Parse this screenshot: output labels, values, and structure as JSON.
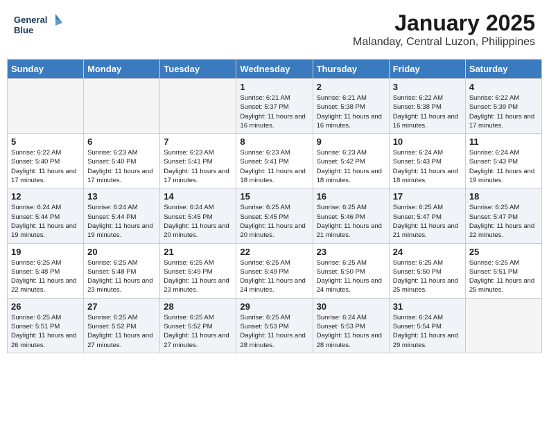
{
  "logo": {
    "line1": "General",
    "line2": "Blue"
  },
  "title": "January 2025",
  "subtitle": "Malanday, Central Luzon, Philippines",
  "days_of_week": [
    "Sunday",
    "Monday",
    "Tuesday",
    "Wednesday",
    "Thursday",
    "Friday",
    "Saturday"
  ],
  "weeks": [
    [
      {
        "day": "",
        "info": ""
      },
      {
        "day": "",
        "info": ""
      },
      {
        "day": "",
        "info": ""
      },
      {
        "day": "1",
        "info": "Sunrise: 6:21 AM\nSunset: 5:37 PM\nDaylight: 11 hours and 16 minutes."
      },
      {
        "day": "2",
        "info": "Sunrise: 6:21 AM\nSunset: 5:38 PM\nDaylight: 11 hours and 16 minutes."
      },
      {
        "day": "3",
        "info": "Sunrise: 6:22 AM\nSunset: 5:38 PM\nDaylight: 11 hours and 16 minutes."
      },
      {
        "day": "4",
        "info": "Sunrise: 6:22 AM\nSunset: 5:39 PM\nDaylight: 11 hours and 17 minutes."
      }
    ],
    [
      {
        "day": "5",
        "info": "Sunrise: 6:22 AM\nSunset: 5:40 PM\nDaylight: 11 hours and 17 minutes."
      },
      {
        "day": "6",
        "info": "Sunrise: 6:23 AM\nSunset: 5:40 PM\nDaylight: 11 hours and 17 minutes."
      },
      {
        "day": "7",
        "info": "Sunrise: 6:23 AM\nSunset: 5:41 PM\nDaylight: 11 hours and 17 minutes."
      },
      {
        "day": "8",
        "info": "Sunrise: 6:23 AM\nSunset: 5:41 PM\nDaylight: 11 hours and 18 minutes."
      },
      {
        "day": "9",
        "info": "Sunrise: 6:23 AM\nSunset: 5:42 PM\nDaylight: 11 hours and 18 minutes."
      },
      {
        "day": "10",
        "info": "Sunrise: 6:24 AM\nSunset: 5:43 PM\nDaylight: 11 hours and 18 minutes."
      },
      {
        "day": "11",
        "info": "Sunrise: 6:24 AM\nSunset: 5:43 PM\nDaylight: 11 hours and 19 minutes."
      }
    ],
    [
      {
        "day": "12",
        "info": "Sunrise: 6:24 AM\nSunset: 5:44 PM\nDaylight: 11 hours and 19 minutes."
      },
      {
        "day": "13",
        "info": "Sunrise: 6:24 AM\nSunset: 5:44 PM\nDaylight: 11 hours and 19 minutes."
      },
      {
        "day": "14",
        "info": "Sunrise: 6:24 AM\nSunset: 5:45 PM\nDaylight: 11 hours and 20 minutes."
      },
      {
        "day": "15",
        "info": "Sunrise: 6:25 AM\nSunset: 5:45 PM\nDaylight: 11 hours and 20 minutes."
      },
      {
        "day": "16",
        "info": "Sunrise: 6:25 AM\nSunset: 5:46 PM\nDaylight: 11 hours and 21 minutes."
      },
      {
        "day": "17",
        "info": "Sunrise: 6:25 AM\nSunset: 5:47 PM\nDaylight: 11 hours and 21 minutes."
      },
      {
        "day": "18",
        "info": "Sunrise: 6:25 AM\nSunset: 5:47 PM\nDaylight: 11 hours and 22 minutes."
      }
    ],
    [
      {
        "day": "19",
        "info": "Sunrise: 6:25 AM\nSunset: 5:48 PM\nDaylight: 11 hours and 22 minutes."
      },
      {
        "day": "20",
        "info": "Sunrise: 6:25 AM\nSunset: 5:48 PM\nDaylight: 11 hours and 23 minutes."
      },
      {
        "day": "21",
        "info": "Sunrise: 6:25 AM\nSunset: 5:49 PM\nDaylight: 11 hours and 23 minutes."
      },
      {
        "day": "22",
        "info": "Sunrise: 6:25 AM\nSunset: 5:49 PM\nDaylight: 11 hours and 24 minutes."
      },
      {
        "day": "23",
        "info": "Sunrise: 6:25 AM\nSunset: 5:50 PM\nDaylight: 11 hours and 24 minutes."
      },
      {
        "day": "24",
        "info": "Sunrise: 6:25 AM\nSunset: 5:50 PM\nDaylight: 11 hours and 25 minutes."
      },
      {
        "day": "25",
        "info": "Sunrise: 6:25 AM\nSunset: 5:51 PM\nDaylight: 11 hours and 25 minutes."
      }
    ],
    [
      {
        "day": "26",
        "info": "Sunrise: 6:25 AM\nSunset: 5:51 PM\nDaylight: 11 hours and 26 minutes."
      },
      {
        "day": "27",
        "info": "Sunrise: 6:25 AM\nSunset: 5:52 PM\nDaylight: 11 hours and 27 minutes."
      },
      {
        "day": "28",
        "info": "Sunrise: 6:25 AM\nSunset: 5:52 PM\nDaylight: 11 hours and 27 minutes."
      },
      {
        "day": "29",
        "info": "Sunrise: 6:25 AM\nSunset: 5:53 PM\nDaylight: 11 hours and 28 minutes."
      },
      {
        "day": "30",
        "info": "Sunrise: 6:24 AM\nSunset: 5:53 PM\nDaylight: 11 hours and 28 minutes."
      },
      {
        "day": "31",
        "info": "Sunrise: 6:24 AM\nSunset: 5:54 PM\nDaylight: 11 hours and 29 minutes."
      },
      {
        "day": "",
        "info": ""
      }
    ]
  ]
}
